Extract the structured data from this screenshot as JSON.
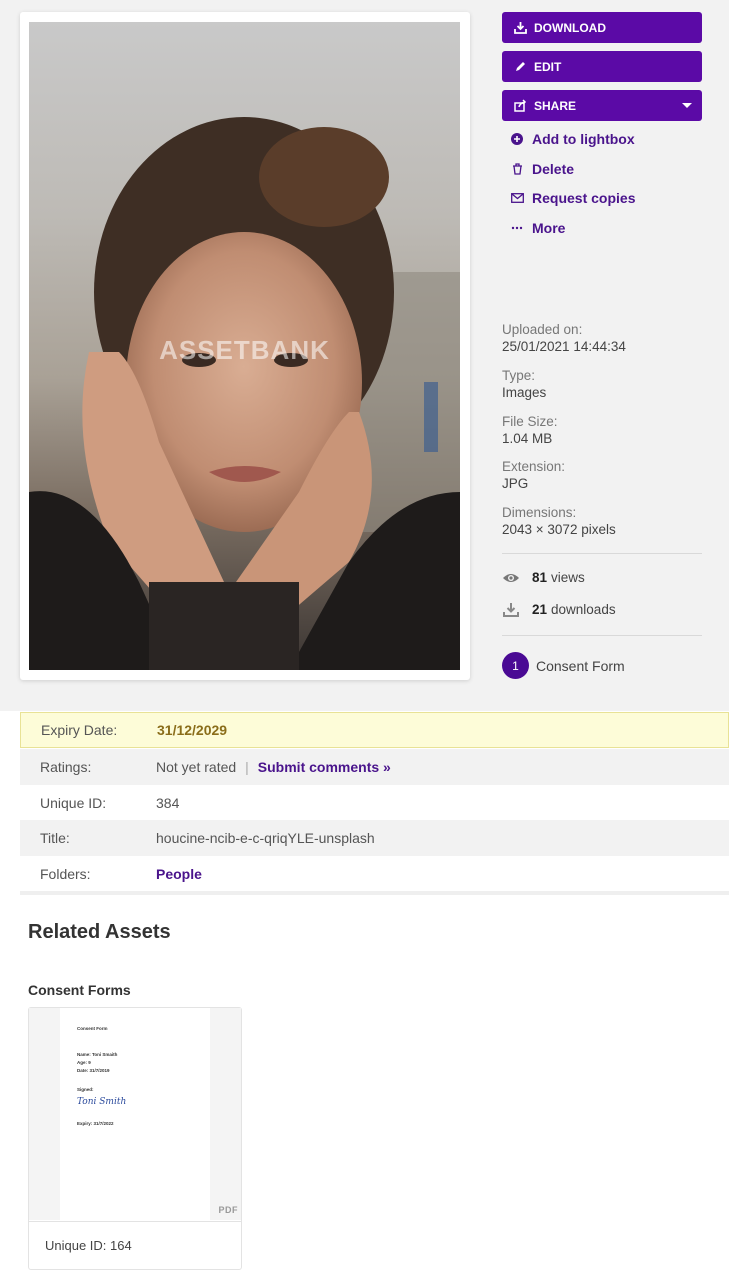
{
  "image": {
    "watermark": "ASSETBANK"
  },
  "actions": {
    "download": "DOWNLOAD",
    "edit": "EDIT",
    "share": "SHARE",
    "add_to_lightbox": "Add to lightbox",
    "delete": "Delete",
    "request_copies": "Request copies",
    "more": "More"
  },
  "meta": [
    {
      "label": "Uploaded on:",
      "value": "25/01/2021 14:44:34"
    },
    {
      "label": "Type:",
      "value": "Images"
    },
    {
      "label": "File Size:",
      "value": "1.04 MB"
    },
    {
      "label": "Extension:",
      "value": "JPG"
    },
    {
      "label": "Dimensions:",
      "value": "2043 × 3072 pixels"
    }
  ],
  "stats": {
    "views_count": "81",
    "views_label": "views",
    "downloads_count": "21",
    "downloads_label": "downloads"
  },
  "consent": {
    "count": "1",
    "label": "Consent Form"
  },
  "attributes": {
    "expiry_label": "Expiry Date:",
    "expiry_value": "31/12/2029",
    "ratings_label": "Ratings:",
    "ratings_value": "Not yet rated",
    "ratings_separator": "|",
    "submit_comments": "Submit comments »",
    "unique_id_label": "Unique ID:",
    "unique_id_value": "384",
    "title_label": "Title:",
    "title_value": "houcine-ncib-e-c-qriqYLE-unsplash",
    "folders_label": "Folders:",
    "folders_value": "People"
  },
  "related": {
    "heading": "Related Assets",
    "consent_heading": "Consent Forms",
    "doc": {
      "page_title": "Consent Form",
      "name": "Name: Toni Smaith",
      "age": "Age: 9",
      "date": "Date: 31/7/2019",
      "signed": "Signed:",
      "signature": "Toni Smith",
      "expiry": "Expiry: 31/7/2022",
      "file_type": "PDF",
      "unique_id": "Unique ID: 164"
    }
  },
  "colors": {
    "accent": "#5b0aa6",
    "link": "#4a148c",
    "expiry_bg": "#fdfcd8"
  }
}
